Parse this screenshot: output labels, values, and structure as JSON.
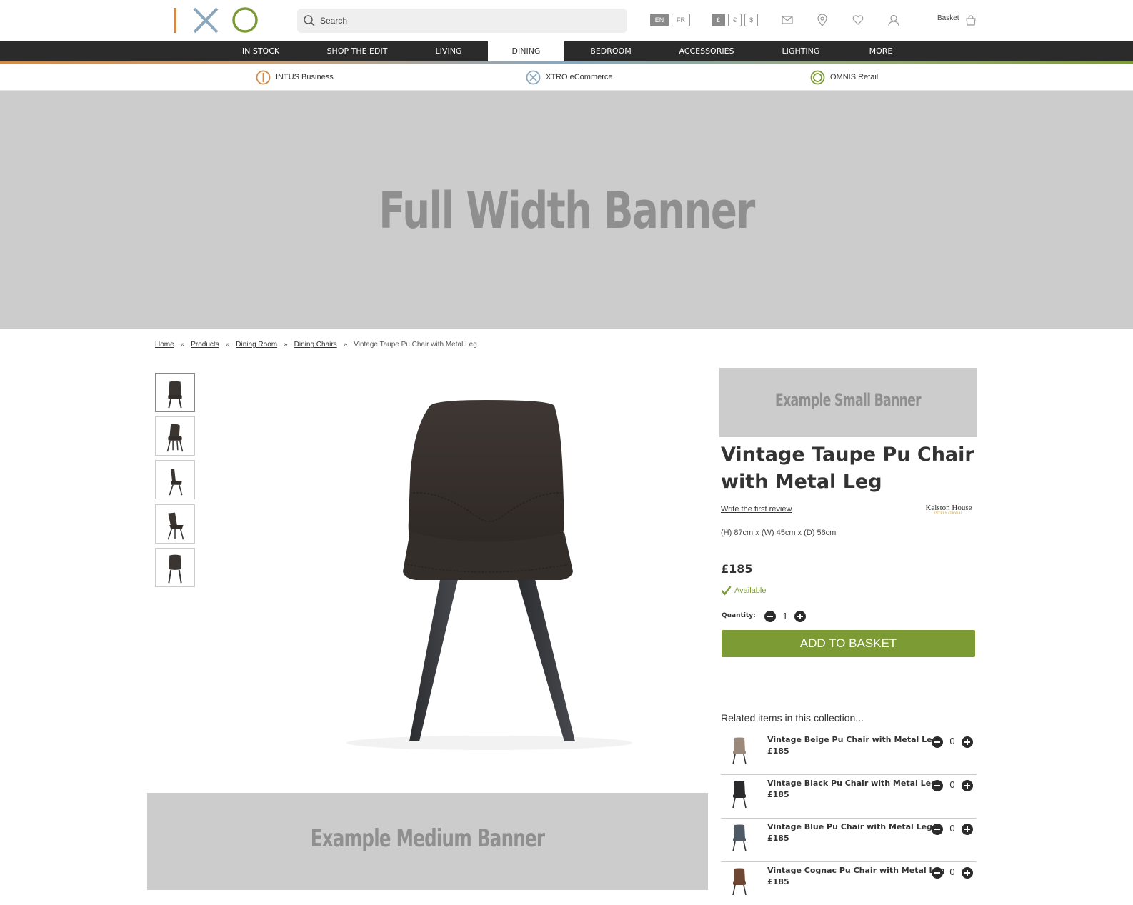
{
  "header": {
    "logo_text": "IXO",
    "search": {
      "placeholder": "Search"
    },
    "languages": [
      {
        "label": "EN",
        "active": true
      },
      {
        "label": "FR",
        "active": false
      }
    ],
    "currencies": [
      {
        "label": "£",
        "active": true
      },
      {
        "label": "€",
        "active": false
      },
      {
        "label": "$",
        "active": false
      }
    ],
    "icons": [
      "mail-icon",
      "location-pin-icon",
      "heart-icon",
      "user-icon",
      "basket-icon"
    ],
    "basket_label": "Basket"
  },
  "nav": {
    "items": [
      "IN STOCK",
      "SHOP THE EDIT",
      "LIVING",
      "DINING",
      "BEDROOM",
      "ACCESSORIES",
      "LIGHTING",
      "MORE"
    ],
    "active": "DINING"
  },
  "brands": [
    {
      "label": "INTUS Business",
      "color": "#d38a46",
      "icon": "intus-logo-icon"
    },
    {
      "label": "XTRO eCommerce",
      "color": "#8aa7bd",
      "icon": "xtro-logo-icon"
    },
    {
      "label": "OMNIS Retail",
      "color": "#7c9b38",
      "icon": "omnis-logo-icon"
    }
  ],
  "banners": {
    "full": "Full Width Banner",
    "small": "Example Small Banner",
    "medium": "Example Medium Banner"
  },
  "breadcrumb": {
    "items": [
      "Home",
      "Products",
      "Dining Room",
      "Dining Chairs"
    ],
    "current": "Vintage Taupe Pu Chair with Metal Leg",
    "separator": "»"
  },
  "product": {
    "title": "Vintage Taupe Pu Chair with Metal Leg",
    "review_link": "Write the first review",
    "brand_name": "Kelston House",
    "brand_sub": "INTERNATIONAL",
    "dimensions": "(H) 87cm x (W) 45cm x (D) 56cm",
    "price": "£185",
    "availability": "Available",
    "quantity_label": "Quantity:",
    "quantity": "1",
    "add_to_basket": "ADD TO BASKET",
    "thumbnail_count": 5
  },
  "related": {
    "title": "Related items in this collection...",
    "items": [
      {
        "name": "Vintage Beige Pu Chair with Metal Leg",
        "price": "£185",
        "qty": "0",
        "color": "#9b8a7c"
      },
      {
        "name": "Vintage Black Pu Chair with Metal Leg",
        "price": "£185",
        "qty": "0",
        "color": "#2a2a2c"
      },
      {
        "name": "Vintage Blue Pu Chair with Metal Leg",
        "price": "£185",
        "qty": "0",
        "color": "#4f5a66"
      },
      {
        "name": "Vintage Cognac Pu Chair with Metal Leg",
        "price": "£185",
        "qty": "0",
        "color": "#6e4634"
      }
    ]
  },
  "colors": {
    "nav_bg": "#2b2b2b",
    "accent_green": "#7c9b35",
    "banner_bg": "#cccccc",
    "banner_text": "#8f8f8f",
    "chair_main": "#3b3532"
  }
}
